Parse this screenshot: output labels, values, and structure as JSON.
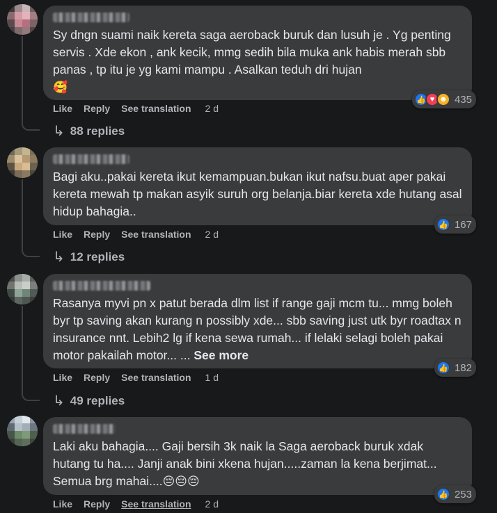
{
  "comments": [
    {
      "text": "Sy dngn suami naik kereta saga aeroback buruk dan lusuh je . Yg penting servis . Xde ekon , ank kecik, mmg sedih bila muka ank habis merah sbb panas , tp itu je yg kami mampu . Asalkan teduh dri hujan",
      "emoji": "🥰",
      "reaction_count": "435",
      "age": "2 d",
      "replies": "88 replies"
    },
    {
      "text": "Bagi aku..pakai kereta ikut kemampuan.bukan ikut nafsu.buat aper pakai kereta mewah tp makan asyik suruh org belanja.biar kereta xde hutang asal hidup bahagia..",
      "reaction_count": "167",
      "age": "2 d",
      "replies": "12 replies"
    },
    {
      "text": "Rasanya myvi pn x patut berada dlm list if range gaji mcm tu... mmg boleh byr tp saving akan kurang n possibly xde... sbb saving just utk byr roadtax n insurance nnt. Lebih2 lg if kena sewa rumah... if lelaki selagi boleh pakai motor pakailah motor... ...",
      "see_more": "See more",
      "reaction_count": "182",
      "age": "1 d",
      "replies": "49 replies"
    },
    {
      "text": "Laki aku bahagia.... Gaji bersih 3k naik la Saga aeroback buruk xdak hutang tu ha.... Janji anak bini xkena hujan.....zaman la kena berjimat... Semua brg mahai....",
      "emoji": "😔😔😔",
      "reaction_count": "253",
      "age": "2 d"
    }
  ],
  "actions": {
    "like": "Like",
    "reply": "Reply",
    "translate": "See translation"
  },
  "colors": {
    "background": "#18191a",
    "bubble": "#3a3b3c",
    "text": "#e4e6eb",
    "secondary_text": "#b0b3b8",
    "like_blue": "#1877f2"
  }
}
